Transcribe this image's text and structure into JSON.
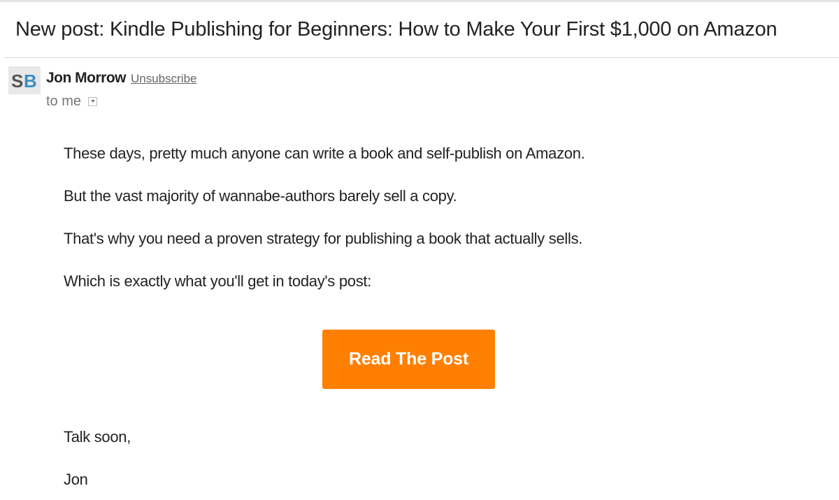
{
  "email": {
    "subject": "New post: Kindle Publishing for Beginners: How to Make Your First $1,000 on Amazon",
    "sender": {
      "avatar_initials": "SB",
      "name": "Jon Morrow",
      "unsubscribe_label": "Unsubscribe"
    },
    "recipient_label": "to me",
    "body": {
      "paragraphs": [
        "These days, pretty much anyone can write a book and self-publish on Amazon.",
        "But the vast majority of wannabe-authors barely sell a copy.",
        "That's why you need a proven strategy for publishing a book that actually sells.",
        "Which is exactly what you'll get in today's post:"
      ],
      "cta_label": "Read The Post",
      "signoff": "Talk soon,",
      "signature": "Jon"
    }
  },
  "colors": {
    "cta_background": "#ff7f00",
    "cta_text": "#ffffff",
    "avatar_s": "#555555",
    "avatar_b": "#3a8fc8"
  },
  "icons": {
    "avatar": "sb-logo-avatar",
    "recipient_details": "chevron-down-icon"
  }
}
